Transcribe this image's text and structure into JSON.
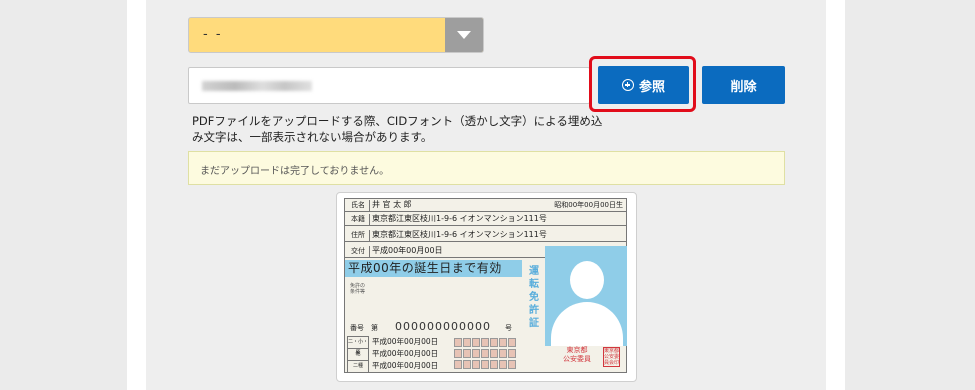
{
  "form": {
    "select_value": "- -",
    "file_name": "",
    "browse_label": "参照",
    "delete_label": "削除",
    "note": "PDFファイルをアップロードする際、CIDフォント（透かし文字）による埋め込み文字は、一部表示されない場合があります。",
    "status": "まだアップロードは完了しておりません。"
  },
  "license": {
    "name_label": "氏名",
    "name_value": "井 官 太 郎",
    "birth": "昭和00年00月00日生",
    "honseki_label": "本籍",
    "honseki_value": "東京都江東区枝川1-9-6 イオンマンション111号",
    "address_label": "住所",
    "address_value": "東京都江東区枝川1-9-6 イオンマンション111号",
    "issue_label": "交付",
    "issue_value": "平成00年00月00日",
    "validity": "平成00年の誕生日まで有効",
    "conditions": "免許の\n条件等",
    "vertical_text": "運転免許証",
    "number_label": "番号",
    "number_prefix": "第",
    "number_value": "000000000000",
    "number_suffix": "号",
    "class_rows": [
      {
        "label": "二・小・原",
        "value": "平成00年00月00日"
      },
      {
        "label": "他",
        "value": "平成00年00月00日"
      },
      {
        "label": "二種",
        "value": "平成00年00月00日"
      }
    ],
    "issuer": "東京都\n公安委員",
    "seal": "東京都公安委員会印"
  },
  "colors": {
    "select_bg": "#ffdb7c",
    "button_blue": "#0b6bbf",
    "highlight_red": "#e10c1a",
    "status_bg": "#fdfbdf"
  },
  "icons": {
    "browse": "plus-circle-icon",
    "dropdown": "triangle-down-icon"
  }
}
